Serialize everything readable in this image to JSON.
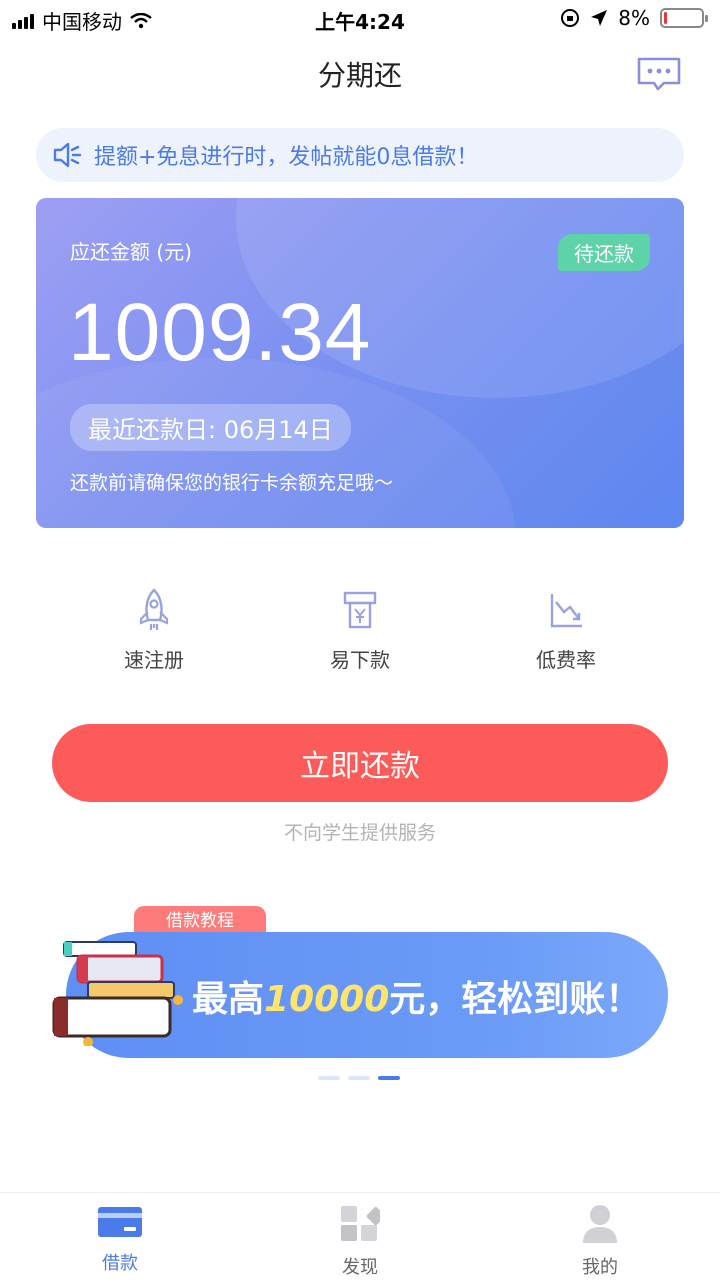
{
  "status_bar": {
    "carrier": "中国移动",
    "time": "上午4:24",
    "battery": "8%",
    "battery_level": 0.08
  },
  "nav": {
    "title": "分期还",
    "message_icon": "message-icon"
  },
  "notice": {
    "icon": "speaker-icon",
    "text": "提额+免息进行时，发帖就能0息借款！"
  },
  "card": {
    "label": "应还金额 (元)",
    "status": "待还款",
    "amount": "1009.34",
    "due_date": "最近还款日: 06月14日",
    "tip": "还款前请确保您的银行卡余额充足哦～"
  },
  "features": [
    {
      "icon": "rocket-icon",
      "label": "速注册"
    },
    {
      "icon": "cash-machine-icon",
      "label": "易下款"
    },
    {
      "icon": "chart-down-icon",
      "label": "低费率"
    }
  ],
  "action": {
    "repay_label": "立即还款",
    "disclaimer": "不向学生提供服务"
  },
  "banner": {
    "tag": "借款教程",
    "text_prefix": "最高",
    "text_highlight": "10000",
    "text_suffix": "元，轻松到账！",
    "page_count": 3,
    "active_page": 3
  },
  "tabbar": [
    {
      "icon": "card-icon",
      "label": "借款",
      "active": true
    },
    {
      "icon": "discover-icon",
      "label": "发现",
      "active": false
    },
    {
      "icon": "user-icon",
      "label": "我的",
      "active": false
    }
  ],
  "colors": {
    "accent": "#4b7be8",
    "button": "#fd5a5a",
    "status_badge": "#5ed3a8"
  }
}
